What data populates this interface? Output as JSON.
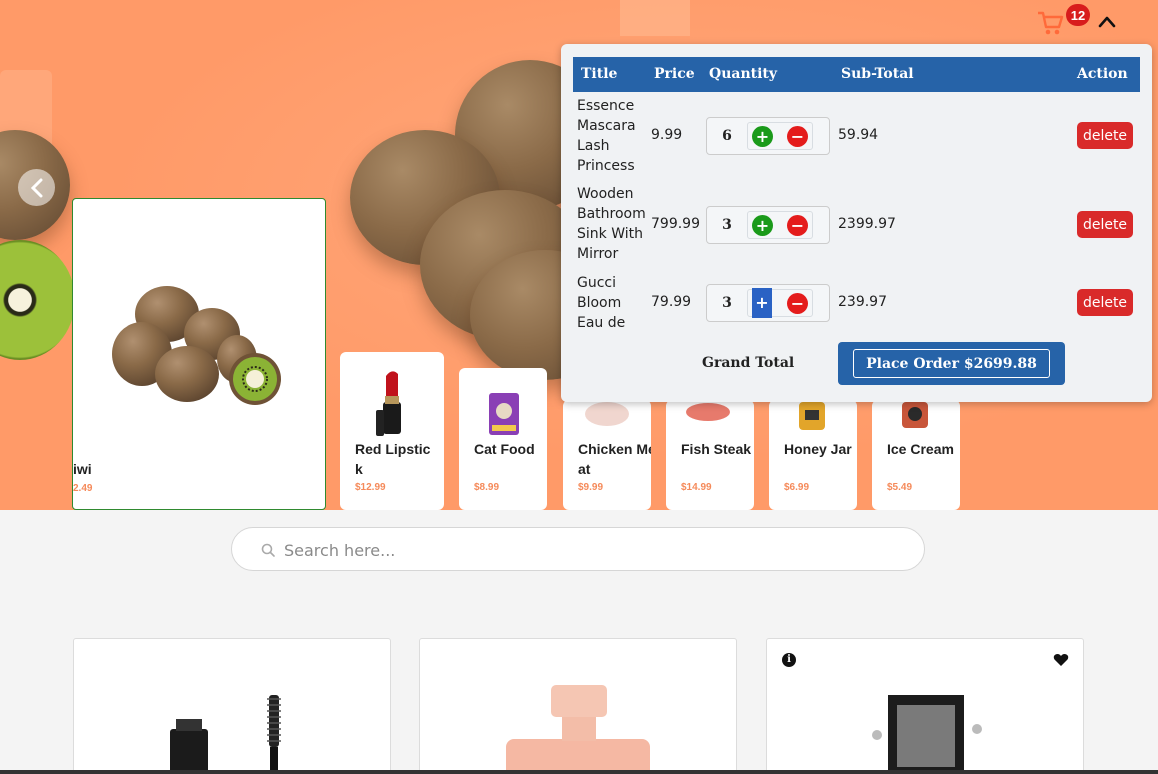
{
  "header": {
    "cart_count": "12",
    "cart_icon": "shopping-cart-icon",
    "toggle_icon": "chevron-up-icon"
  },
  "carousel": {
    "featured": {
      "name": "iwi",
      "price": "2.49"
    },
    "items": [
      {
        "name": "Red Lipstick",
        "price": "$12.99"
      },
      {
        "name": "Cat Food",
        "price": "$8.99"
      },
      {
        "name": "Chicken Meat",
        "price": "$9.99"
      },
      {
        "name": "Fish Steak",
        "price": "$14.99"
      },
      {
        "name": "Honey Jar",
        "price": "$6.99"
      },
      {
        "name": "Ice Cream",
        "price": "$5.49"
      }
    ]
  },
  "cart": {
    "headers": {
      "title": "Title",
      "price": "Price",
      "quantity": "Quantity",
      "subtotal": "Sub-Total",
      "action": "Action"
    },
    "rows": [
      {
        "title": "Essence Mascara Lash Princess",
        "price": "9.99",
        "qty": "6",
        "subtotal": "59.94",
        "action": "delete"
      },
      {
        "title": "Wooden Bathroom Sink With Mirror",
        "price": "799.99",
        "qty": "3",
        "subtotal": "2399.97",
        "action": "delete"
      },
      {
        "title": "Gucci Bloom Eau de",
        "price": "79.99",
        "qty": "3",
        "subtotal": "239.97",
        "action": "delete"
      }
    ],
    "grand_total_label": "Grand Total",
    "place_order_label": "Place Order $2699.88"
  },
  "search": {
    "placeholder": "Search here..."
  },
  "colors": {
    "hero_bg": "#ff9a68",
    "cart_header": "#2663a8",
    "delete_red": "#d92a2a",
    "plus_green": "#1a9a1a",
    "minus_red": "#e41c1c",
    "price_orange": "#f58a5a"
  }
}
